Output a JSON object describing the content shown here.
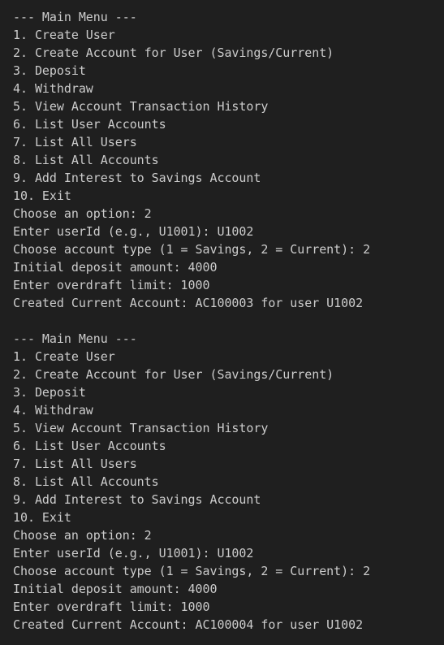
{
  "terminal": {
    "blocks": [
      {
        "lines": [
          "--- Main Menu ---",
          "1. Create User",
          "2. Create Account for User (Savings/Current)",
          "3. Deposit",
          "4. Withdraw",
          "5. View Account Transaction History",
          "6. List User Accounts",
          "7. List All Users",
          "8. List All Accounts",
          "9. Add Interest to Savings Account",
          "10. Exit",
          "Choose an option: 2",
          "Enter userId (e.g., U1001): U1002",
          "Choose account type (1 = Savings, 2 = Current): 2",
          "Initial deposit amount: 4000",
          "Enter overdraft limit: 1000",
          "Created Current Account: AC100003 for user U1002"
        ]
      },
      {
        "lines": [
          "--- Main Menu ---",
          "1. Create User",
          "2. Create Account for User (Savings/Current)",
          "3. Deposit",
          "4. Withdraw",
          "5. View Account Transaction History",
          "6. List User Accounts",
          "7. List All Users",
          "8. List All Accounts",
          "9. Add Interest to Savings Account",
          "10. Exit",
          "Choose an option: 2",
          "Enter userId (e.g., U1001): U1002",
          "Choose account type (1 = Savings, 2 = Current): 2",
          "Initial deposit amount: 4000",
          "Enter overdraft limit: 1000",
          "Created Current Account: AC100004 for user U1002"
        ]
      }
    ],
    "colors": {
      "background": "#1f1f1f",
      "text": "#cccccc"
    }
  }
}
